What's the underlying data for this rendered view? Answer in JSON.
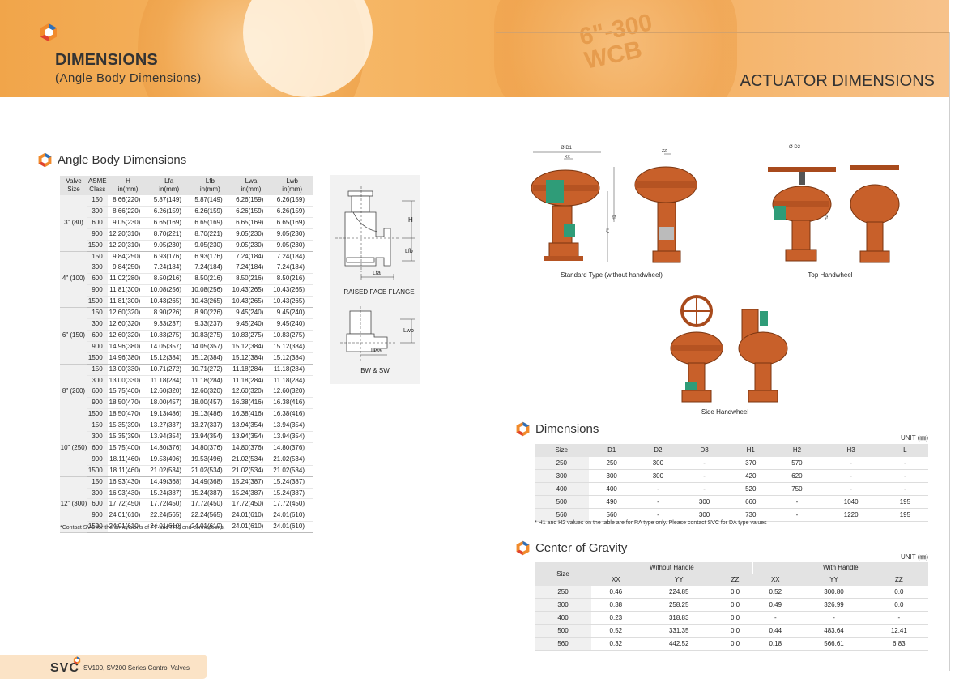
{
  "header": {
    "title": "DIMENSIONS",
    "subtitle": "(Angle Body Dimensions)",
    "right_title": "ACTUATOR DIMENSIONS",
    "cast_mark_1": "6\"-300",
    "cast_mark_2": "WCB"
  },
  "angle_body": {
    "section_title": "Angle Body Dimensions",
    "headers": [
      {
        "l1": "Valve",
        "l2": "Size"
      },
      {
        "l1": "ASME",
        "l2": "Class"
      },
      {
        "l1": "H",
        "l2": "in(mm)"
      },
      {
        "l1": "Lfa",
        "l2": "in(mm)"
      },
      {
        "l1": "Lfb",
        "l2": "in(mm)"
      },
      {
        "l1": "Lwa",
        "l2": "in(mm)"
      },
      {
        "l1": "Lwb",
        "l2": "in(mm)"
      }
    ],
    "groups": [
      {
        "size": "3\" (80)",
        "rows": [
          [
            "150",
            "8.66(220)",
            "5.87(149)",
            "5.87(149)",
            "6.26(159)",
            "6.26(159)"
          ],
          [
            "300",
            "8.66(220)",
            "6.26(159)",
            "6.26(159)",
            "6.26(159)",
            "6.26(159)"
          ],
          [
            "600",
            "9.05(230)",
            "6.65(169)",
            "6.65(169)",
            "6.65(169)",
            "6.65(169)"
          ],
          [
            "900",
            "12.20(310)",
            "8.70(221)",
            "8.70(221)",
            "9.05(230)",
            "9.05(230)"
          ],
          [
            "1500",
            "12.20(310)",
            "9.05(230)",
            "9.05(230)",
            "9.05(230)",
            "9.05(230)"
          ]
        ]
      },
      {
        "size": "4\" (100)",
        "rows": [
          [
            "150",
            "9.84(250)",
            "6.93(176)",
            "6.93(176)",
            "7.24(184)",
            "7.24(184)"
          ],
          [
            "300",
            "9.84(250)",
            "7.24(184)",
            "7.24(184)",
            "7.24(184)",
            "7.24(184)"
          ],
          [
            "600",
            "11.02(280)",
            "8.50(216)",
            "8.50(216)",
            "8.50(216)",
            "8.50(216)"
          ],
          [
            "900",
            "11.81(300)",
            "10.08(256)",
            "10.08(256)",
            "10.43(265)",
            "10.43(265)"
          ],
          [
            "1500",
            "11.81(300)",
            "10.43(265)",
            "10.43(265)",
            "10.43(265)",
            "10.43(265)"
          ]
        ]
      },
      {
        "size": "6\" (150)",
        "rows": [
          [
            "150",
            "12.60(320)",
            "8.90(226)",
            "8.90(226)",
            "9.45(240)",
            "9.45(240)"
          ],
          [
            "300",
            "12.60(320)",
            "9.33(237)",
            "9.33(237)",
            "9.45(240)",
            "9.45(240)"
          ],
          [
            "600",
            "12.60(320)",
            "10.83(275)",
            "10.83(275)",
            "10.83(275)",
            "10.83(275)"
          ],
          [
            "900",
            "14.96(380)",
            "14.05(357)",
            "14.05(357)",
            "15.12(384)",
            "15.12(384)"
          ],
          [
            "1500",
            "14.96(380)",
            "15.12(384)",
            "15.12(384)",
            "15.12(384)",
            "15.12(384)"
          ]
        ]
      },
      {
        "size": "8\" (200)",
        "rows": [
          [
            "150",
            "13.00(330)",
            "10.71(272)",
            "10.71(272)",
            "11.18(284)",
            "11.18(284)"
          ],
          [
            "300",
            "13.00(330)",
            "11.18(284)",
            "11.18(284)",
            "11.18(284)",
            "11.18(284)"
          ],
          [
            "600",
            "15.75(400)",
            "12.60(320)",
            "12.60(320)",
            "12.60(320)",
            "12.60(320)"
          ],
          [
            "900",
            "18.50(470)",
            "18.00(457)",
            "18.00(457)",
            "16.38(416)",
            "16.38(416)"
          ],
          [
            "1500",
            "18.50(470)",
            "19.13(486)",
            "19.13(486)",
            "16.38(416)",
            "16.38(416)"
          ]
        ]
      },
      {
        "size": "10\" (250)",
        "rows": [
          [
            "150",
            "15.35(390)",
            "13.27(337)",
            "13.27(337)",
            "13.94(354)",
            "13.94(354)"
          ],
          [
            "300",
            "15.35(390)",
            "13.94(354)",
            "13.94(354)",
            "13.94(354)",
            "13.94(354)"
          ],
          [
            "600",
            "15.75(400)",
            "14.80(376)",
            "14.80(376)",
            "14.80(376)",
            "14.80(376)"
          ],
          [
            "900",
            "18.11(460)",
            "19.53(496)",
            "19.53(496)",
            "21.02(534)",
            "21.02(534)"
          ],
          [
            "1500",
            "18.11(460)",
            "21.02(534)",
            "21.02(534)",
            "21.02(534)",
            "21.02(534)"
          ]
        ]
      },
      {
        "size": "12\" (300)",
        "rows": [
          [
            "150",
            "16.93(430)",
            "14.49(368)",
            "14.49(368)",
            "15.24(387)",
            "15.24(387)"
          ],
          [
            "300",
            "16.93(430)",
            "15.24(387)",
            "15.24(387)",
            "15.24(387)",
            "15.24(387)"
          ],
          [
            "600",
            "17.72(450)",
            "17.72(450)",
            "17.72(450)",
            "17.72(450)",
            "17.72(450)"
          ],
          [
            "900",
            "24.01(610)",
            "22.24(565)",
            "22.24(565)",
            "24.01(610)",
            "24.01(610)"
          ],
          [
            "1500",
            "24.01(610)",
            "24.01(610)",
            "24.01(610)",
            "24.01(610)",
            "24.01(610)"
          ]
        ]
      }
    ],
    "note": "*Contact SVC for the dimensions of FF and RTJ end connections.",
    "diagram_flange_caption": "RAISED FACE FLANGE",
    "diagram_bw_caption": "BW & SW",
    "dim_labels": {
      "h": "H",
      "lfb": "Lfb",
      "lfa": "Lfa",
      "lwb": "Lwb",
      "lwa": "Lwa"
    }
  },
  "actuator_views": {
    "standard": "Standard Type (without handwheel)",
    "top": "Top Handwheel",
    "side": "Side Handwheel",
    "dim_labels": {
      "d1": "Ø D1",
      "d2": "Ø D2",
      "xx": "XX",
      "zz": "ZZ",
      "h1": "H1",
      "h2": "H2",
      "yy": "YY"
    }
  },
  "dimensions": {
    "section_title": "Dimensions",
    "unit": "UNIT (㎜)",
    "headers": [
      "Size",
      "D1",
      "D2",
      "D3",
      "H1",
      "H2",
      "H3",
      "L"
    ],
    "rows": [
      [
        "250",
        "250",
        "300",
        "-",
        "370",
        "570",
        "-",
        "-"
      ],
      [
        "300",
        "300",
        "300",
        "-",
        "420",
        "620",
        "-",
        "-"
      ],
      [
        "400",
        "400",
        "-",
        "-",
        "520",
        "750",
        "-",
        "-"
      ],
      [
        "500",
        "490",
        "-",
        "300",
        "660",
        "-",
        "1040",
        "195"
      ],
      [
        "560",
        "560",
        "-",
        "300",
        "730",
        "-",
        "1220",
        "195"
      ]
    ],
    "note": "* H1 and H2 values on the table are for RA type only. Please contact SVC for DA type values"
  },
  "gravity": {
    "section_title": "Center of Gravity",
    "unit": "UNIT (㎜)",
    "size_header": "Size",
    "group_without": "Without Handle",
    "group_with": "With Handle",
    "sub_headers": [
      "XX",
      "YY",
      "ZZ",
      "XX",
      "YY",
      "ZZ"
    ],
    "rows": [
      [
        "250",
        "0.46",
        "224.85",
        "0.0",
        "0.52",
        "300.80",
        "0.0"
      ],
      [
        "300",
        "0.38",
        "258.25",
        "0.0",
        "0.49",
        "326.99",
        "0.0"
      ],
      [
        "400",
        "0.23",
        "318.83",
        "0.0",
        "-",
        "-",
        "-"
      ],
      [
        "500",
        "0.52",
        "331.35",
        "0.0",
        "0.44",
        "483.64",
        "12.41"
      ],
      [
        "560",
        "0.32",
        "442.52",
        "0.0",
        "0.18",
        "566.61",
        "6.83"
      ]
    ]
  },
  "footer": {
    "brand": "SVC",
    "text": "SV100, SV200 Series Control Valves"
  },
  "colors": {
    "accent": "#f2a64f",
    "actuator": "#c8602a",
    "spring": "#2f9c78"
  }
}
